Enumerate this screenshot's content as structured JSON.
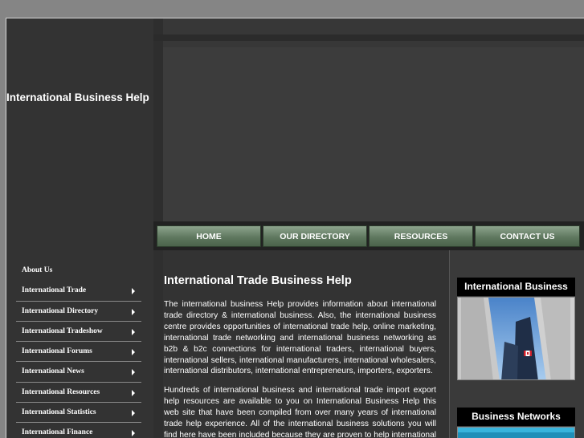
{
  "site": {
    "title": "International Business Help"
  },
  "sidebar": {
    "items": [
      {
        "label": "About Us"
      },
      {
        "label": "International Trade"
      },
      {
        "label": "International Directory"
      },
      {
        "label": "International Tradeshow"
      },
      {
        "label": "International Forums"
      },
      {
        "label": "International News"
      },
      {
        "label": "International Resources"
      },
      {
        "label": "International Statistics"
      },
      {
        "label": "International Finance"
      }
    ]
  },
  "nav": {
    "items": [
      {
        "label": "HOME"
      },
      {
        "label": "OUR DIRECTORY"
      },
      {
        "label": "RESOURCES"
      },
      {
        "label": "CONTACT US"
      }
    ]
  },
  "main": {
    "heading": "International Trade Business Help",
    "paragraph1": "The international business Help provides information about international trade directory & international business. Also, the international business centre provides opportunities of international trade help, online marketing, international trade networking and international business networking as b2b & b2c connections for international traders, international buyers, international sellers, international manufacturers, international wholesalers, international distributors, international entrepreneurs, importers, exporters.",
    "paragraph2": "Hundreds of international business and international trade import export help resources are available to you on International Business Help this web site that have been compiled from over many years of international trade help experience.  All of the international business solutions you will find here have been included because they are proven to help international trade"
  },
  "right": {
    "boxes": [
      {
        "title": "International Business"
      },
      {
        "title": "Business Networks"
      }
    ]
  }
}
